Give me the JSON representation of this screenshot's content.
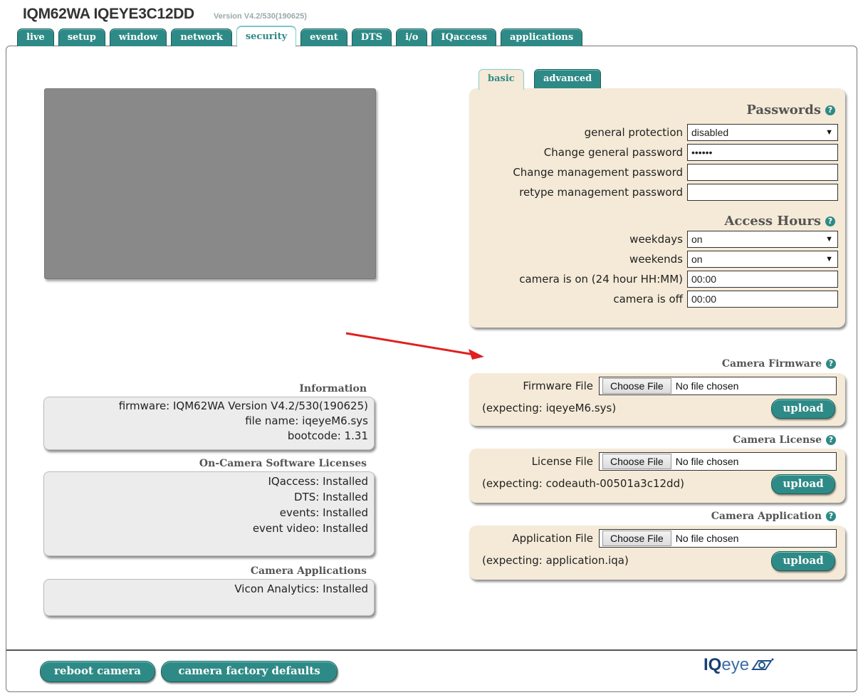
{
  "header": {
    "title": "IQM62WA IQEYE3C12DD",
    "version": "Version V4.2/530(190625)"
  },
  "tabs": [
    {
      "label": "live"
    },
    {
      "label": "setup"
    },
    {
      "label": "window"
    },
    {
      "label": "network"
    },
    {
      "label": "security",
      "active": true
    },
    {
      "label": "event"
    },
    {
      "label": "DTS"
    },
    {
      "label": "i/o"
    },
    {
      "label": "IQaccess"
    },
    {
      "label": "applications"
    }
  ],
  "subtabs": {
    "basic": "basic",
    "advanced": "advanced"
  },
  "passwords": {
    "heading": "Passwords",
    "general_protection_label": "general protection",
    "general_protection_value": "disabled",
    "change_general_label": "Change general password",
    "change_general_value": "••••••",
    "change_mgmt_label": "Change management password",
    "change_mgmt_value": "",
    "retype_mgmt_label": "retype management password",
    "retype_mgmt_value": ""
  },
  "access_hours": {
    "heading": "Access Hours",
    "weekdays_label": "weekdays",
    "weekdays_value": "on",
    "weekends_label": "weekends",
    "weekends_value": "on",
    "on_label": "camera is on (24 hour HH:MM)",
    "on_value": "00:00",
    "off_label": "camera is off",
    "off_value": "00:00"
  },
  "firmware": {
    "heading": "Camera Firmware",
    "file_label": "Firmware File",
    "choose": "Choose File",
    "no_file": "No file chosen",
    "expecting": "(expecting: iqeyeM6.sys)",
    "upload": "upload"
  },
  "license": {
    "heading": "Camera License",
    "file_label": "License File",
    "choose": "Choose File",
    "no_file": "No file chosen",
    "expecting": "(expecting: codeauth-00501a3c12dd)",
    "upload": "upload"
  },
  "application": {
    "heading": "Camera Application",
    "file_label": "Application File",
    "choose": "Choose File",
    "no_file": "No file chosen",
    "expecting": "(expecting: application.iqa)",
    "upload": "upload"
  },
  "information": {
    "heading": "Information",
    "lines": [
      "firmware: IQM62WA Version V4.2/530(190625)",
      "file name: iqeyeM6.sys",
      "bootcode: 1.31"
    ]
  },
  "licenses": {
    "heading": "On-Camera Software Licenses",
    "lines": [
      "IQaccess: Installed",
      "DTS: Installed",
      "events: Installed",
      "event video: Installed"
    ]
  },
  "apps": {
    "heading": "Camera Applications",
    "lines": [
      "Vicon Analytics: Installed"
    ]
  },
  "footer": {
    "reboot": "reboot camera",
    "factory": "camera factory defaults"
  },
  "logo": {
    "iq": "IQ",
    "eye": "eye"
  },
  "help_glyph": "?",
  "colors": {
    "teal": "#2e8a86",
    "beige": "#f4ead7",
    "arrow": "#e02020"
  }
}
